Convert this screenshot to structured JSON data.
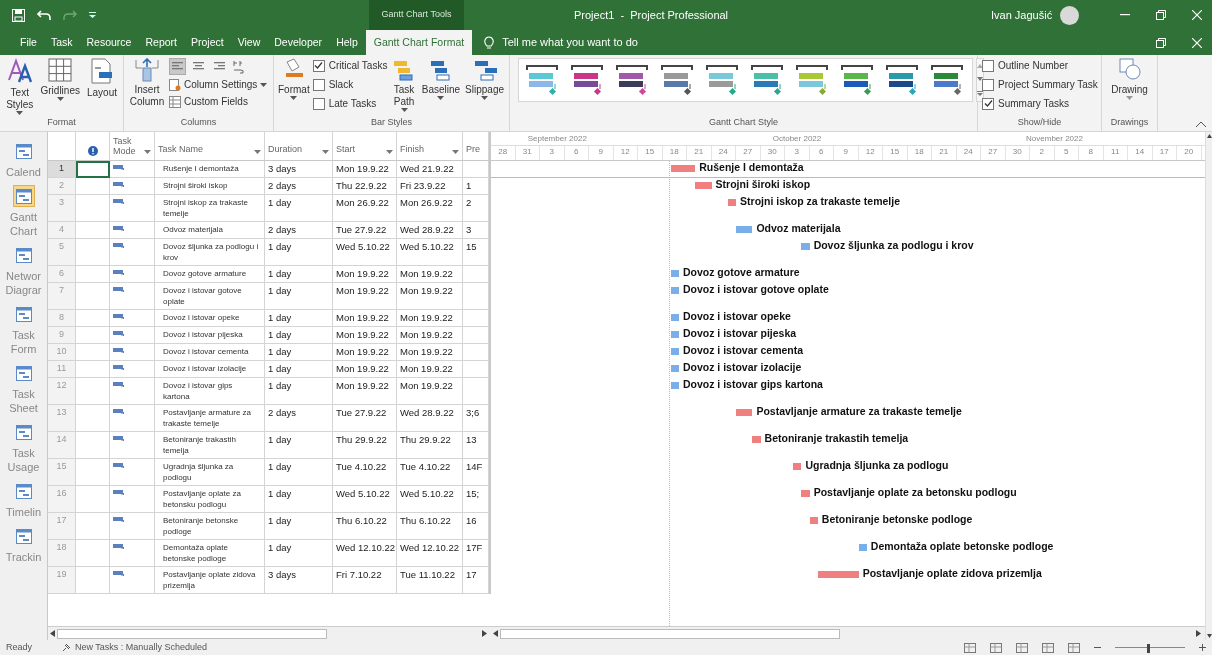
{
  "title_bar": {
    "contextual_group": "Gantt Chart Tools",
    "title": "Project1  -  Project Professional",
    "user": "Ivan Jagušić"
  },
  "ribbon_tabs": [
    {
      "label": "File",
      "selected": false
    },
    {
      "label": "Task",
      "selected": false
    },
    {
      "label": "Resource",
      "selected": false
    },
    {
      "label": "Report",
      "selected": false
    },
    {
      "label": "Project",
      "selected": false
    },
    {
      "label": "View",
      "selected": false
    },
    {
      "label": "Developer",
      "selected": false
    },
    {
      "label": "Help",
      "selected": false
    },
    {
      "label": "Gantt Chart Format",
      "selected": true
    }
  ],
  "tell_me": "Tell me what you want to do",
  "ribbon": {
    "format_group": {
      "label": "Format",
      "buttons": [
        "Text Styles",
        "Gridlines",
        "Layout"
      ]
    },
    "columns_group": {
      "label": "Columns",
      "insert": "Insert Column",
      "align_buttons": [
        {
          "kind": "left",
          "selected": true
        },
        {
          "kind": "center",
          "selected": false
        },
        {
          "kind": "right",
          "selected": false
        }
      ],
      "column_settings": "Column Settings",
      "custom_fields": "Custom Fields"
    },
    "bar_styles_group": {
      "label": "Bar Styles",
      "format": "Format",
      "checkboxes": [
        {
          "label": "Critical Tasks",
          "checked": true
        },
        {
          "label": "Slack",
          "checked": false
        },
        {
          "label": "Late Tasks",
          "checked": false
        }
      ],
      "buttons": [
        "Task Path",
        "Baseline",
        "Slippage"
      ]
    },
    "style_group": {
      "label": "Gantt Chart Style"
    },
    "show_hide_group": {
      "label": "Show/Hide",
      "checkboxes": [
        {
          "label": "Outline Number",
          "checked": false
        },
        {
          "label": "Project Summary Task",
          "checked": false
        },
        {
          "label": "Summary Tasks",
          "checked": true
        }
      ]
    },
    "drawings_group": {
      "label": "Drawings",
      "button": "Drawing"
    }
  },
  "views": [
    {
      "label": "Calend",
      "selected": false
    },
    {
      "label": "Gantt Chart",
      "selected": true
    },
    {
      "label": "Networ Diagrar",
      "selected": false
    },
    {
      "label": "Task Form",
      "selected": false
    },
    {
      "label": "Task Sheet",
      "selected": false
    },
    {
      "label": "Task Usage",
      "selected": false
    },
    {
      "label": "Timelin",
      "selected": false
    },
    {
      "label": "Trackin",
      "selected": false
    }
  ],
  "table": {
    "columns": [
      "Task Mode",
      "Task Name",
      "Duration",
      "Start",
      "Finish",
      "Pre"
    ],
    "rows": [
      {
        "id": "1",
        "name": "Rušenje I demontaža",
        "duration": "3 days",
        "start": "Mon 19.9.22",
        "finish": "Wed 21.9.22",
        "critical": true,
        "selected": true,
        "bar_label": "Rušenje I demontaža"
      },
      {
        "id": "2",
        "name": "Strojni široki iskop",
        "duration": "2 days",
        "start": "Thu 22.9.22",
        "finish": "Fri 23.9.22",
        "predecessors": "1",
        "critical": true,
        "selected": false,
        "bar_label": "Strojni široki iskop"
      },
      {
        "id": "3",
        "name": "Strojni iskop za trakaste temelje",
        "duration": "1 day",
        "start": "Mon 26.9.22",
        "finish": "Mon 26.9.22",
        "predecessors": "2",
        "critical": true,
        "selected": false,
        "bar_label": "Strojni iskop za trakaste temelje"
      },
      {
        "id": "4",
        "name": "Odvoz materijala",
        "duration": "2 days",
        "start": "Tue 27.9.22",
        "finish": "Wed 28.9.22",
        "predecessors": "3",
        "critical": false,
        "selected": false,
        "bar_label": "Odvoz materijala"
      },
      {
        "id": "5",
        "name": "Dovoz šljunka za podlogu i krov",
        "duration": "1 day",
        "start": "Wed 5.10.22",
        "finish": "Wed 5.10.22",
        "predecessors": "15",
        "critical": false,
        "selected": false,
        "bar_label": "Dovoz šljunka za podlogu i krov"
      },
      {
        "id": "6",
        "name": "Dovoz gotove armature",
        "duration": "1 day",
        "start": "Mon 19.9.22",
        "finish": "Mon 19.9.22",
        "critical": false,
        "selected": false,
        "bar_label": "Dovoz gotove armature"
      },
      {
        "id": "7",
        "name": "Dovoz i istovar gotove oplate",
        "duration": "1 day",
        "start": "Mon 19.9.22",
        "finish": "Mon 19.9.22",
        "critical": false,
        "selected": false,
        "bar_label": "Dovoz i istovar gotove oplate"
      },
      {
        "id": "8",
        "name": "Dovoz i istovar opeke",
        "duration": "1 day",
        "start": "Mon 19.9.22",
        "finish": "Mon 19.9.22",
        "critical": false,
        "selected": false,
        "bar_label": "Dovoz i istovar opeke"
      },
      {
        "id": "9",
        "name": "Dovoz i istovar pijeska",
        "duration": "1 day",
        "start": "Mon 19.9.22",
        "finish": "Mon 19.9.22",
        "critical": false,
        "selected": false,
        "bar_label": "Dovoz i istovar pijeska"
      },
      {
        "id": "10",
        "name": "Dovoz i istovar cementa",
        "duration": "1 day",
        "start": "Mon 19.9.22",
        "finish": "Mon 19.9.22",
        "critical": false,
        "selected": false,
        "bar_label": "Dovoz i istovar cementa"
      },
      {
        "id": "11",
        "name": "Dovoz i istovar izolacije",
        "duration": "1 day",
        "start": "Mon 19.9.22",
        "finish": "Mon 19.9.22",
        "critical": false,
        "selected": false,
        "bar_label": "Dovoz i istovar izolacije"
      },
      {
        "id": "12",
        "name": "Dovoz i istovar gips kartona",
        "duration": "1 day",
        "start": "Mon 19.9.22",
        "finish": "Mon 19.9.22",
        "critical": false,
        "selected": false,
        "bar_label": "Dovoz i istovar gips kartona"
      },
      {
        "id": "13",
        "name": "Postavljanje armature za trakaste temelje",
        "duration": "2 days",
        "start": "Tue 27.9.22",
        "finish": "Wed 28.9.22",
        "predecessors": "3;6",
        "critical": true,
        "selected": false,
        "bar_label": "Postavljanje armature za trakaste temelje"
      },
      {
        "id": "14",
        "name": "Betoniranje trakastih temelja",
        "duration": "1 day",
        "start": "Thu 29.9.22",
        "finish": "Thu 29.9.22",
        "predecessors": "13",
        "critical": true,
        "selected": false,
        "bar_label": "Betoniranje trakastih temelja"
      },
      {
        "id": "15",
        "name": "Ugradnja šljunka za podlogu",
        "duration": "1 day",
        "start": "Tue 4.10.22",
        "finish": "Tue 4.10.22",
        "predecessors": "14F",
        "critical": true,
        "selected": false,
        "bar_label": "Ugradnja šljunka za podlogu"
      },
      {
        "id": "16",
        "name": "Postavljanje oplate za betonsku podlogu",
        "duration": "1 day",
        "start": "Wed 5.10.22",
        "finish": "Wed 5.10.22",
        "predecessors": "15;",
        "critical": true,
        "selected": false,
        "bar_label": "Postavljanje oplate za betonsku podlogu"
      },
      {
        "id": "17",
        "name": "Betoniranje betonske podloge",
        "duration": "1 day",
        "start": "Thu 6.10.22",
        "finish": "Thu 6.10.22",
        "predecessors": "16",
        "critical": true,
        "selected": false,
        "bar_label": "Betoniranje betonske podloge"
      },
      {
        "id": "18",
        "name": "Demontaža oplate betonske podloge",
        "duration": "1 day",
        "start": "Wed 12.10.22",
        "finish": "Wed 12.10.22",
        "predecessors": "17F",
        "critical": false,
        "selected": false,
        "bar_label": "Demontaža oplate betonske podloge"
      },
      {
        "id": "19",
        "name": "Postavljanje oplate zidova prizemlja",
        "duration": "3 days",
        "start": "Fri 7.10.22",
        "finish": "Tue 11.10.22",
        "predecessors": "17",
        "critical": true,
        "selected": false,
        "bar_label": "Postavljanje oplate zidova prizemlja"
      }
    ]
  },
  "timescale": {
    "months": [
      "September 2022",
      "October 2022",
      "November 2022"
    ],
    "days": [
      "28",
      "31",
      "3",
      "6",
      "9",
      "12",
      "15",
      "18",
      "21",
      "24",
      "27",
      "30",
      "3",
      "6",
      "9",
      "12",
      "15",
      "18",
      "21",
      "24",
      "27",
      "30",
      "2",
      "5",
      "8",
      "11",
      "14",
      "17",
      "20"
    ]
  },
  "status_bar": {
    "ready": "Ready",
    "new_tasks": "New Tasks : Manually Scheduled",
    "zoom": {
      "level": 0.45
    }
  }
}
